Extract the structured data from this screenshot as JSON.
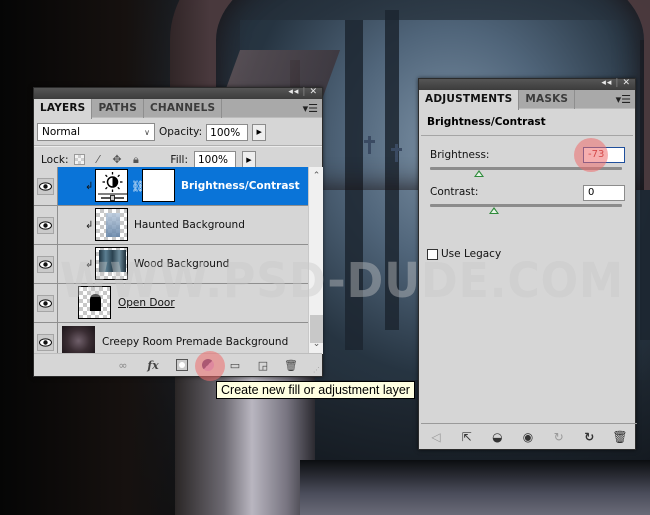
{
  "canvas": {
    "watermark": "WWW.PSD-DUDE.COM"
  },
  "layers_panel": {
    "titlebar_buttons": {
      "collapse": "◂◂",
      "close": "✕"
    },
    "tabs": [
      {
        "label": "LAYERS",
        "active": true
      },
      {
        "label": "PATHS",
        "active": false
      },
      {
        "label": "CHANNELS",
        "active": false
      }
    ],
    "blend_mode": "Normal",
    "opacity_label": "Opacity:",
    "opacity_value": "100%",
    "lock_label": "Lock:",
    "fill_label": "Fill:",
    "fill_value": "100%",
    "layers": [
      {
        "name": "Brightness/Contrast",
        "visible": true,
        "selected": true,
        "clipped": true,
        "type": "adjustment"
      },
      {
        "name": "Haunted Background",
        "visible": true,
        "selected": false,
        "clipped": true,
        "type": "image"
      },
      {
        "name": "Wood Background",
        "visible": true,
        "selected": false,
        "clipped": true,
        "type": "image"
      },
      {
        "name": "Open Door",
        "visible": true,
        "selected": false,
        "clipped": false,
        "type": "shape"
      },
      {
        "name": "Creepy Room Premade Background",
        "visible": true,
        "selected": false,
        "clipped": false,
        "type": "image"
      }
    ],
    "footer_icons": [
      "link-layers-icon",
      "fx-icon",
      "add-mask-icon",
      "new-adjustment-layer-icon",
      "new-group-icon",
      "new-layer-icon",
      "delete-layer-icon"
    ]
  },
  "tooltip": "Create new fill or adjustment layer",
  "adjustments_panel": {
    "titlebar_buttons": {
      "collapse": "◂◂",
      "close": "✕"
    },
    "tabs": [
      {
        "label": "ADJUSTMENTS",
        "active": true
      },
      {
        "label": "MASKS",
        "active": false
      }
    ],
    "title": "Brightness/Contrast",
    "brightness": {
      "label": "Brightness:",
      "value": "-73",
      "min": -150,
      "max": 150
    },
    "contrast": {
      "label": "Contrast:",
      "value": "0",
      "min": -50,
      "max": 100
    },
    "use_legacy": {
      "label": "Use Legacy",
      "checked": false
    },
    "footer_icons": [
      "back-icon",
      "expand-view-icon",
      "clip-to-layer-icon",
      "visibility-icon",
      "view-previous-icon",
      "reset-icon",
      "delete-icon"
    ]
  },
  "colors": {
    "selection": "#0a74d8",
    "panel_bg": "#d6d6d6",
    "highlight": "#ee6e6e",
    "tooltip_bg": "#ffffe1"
  }
}
